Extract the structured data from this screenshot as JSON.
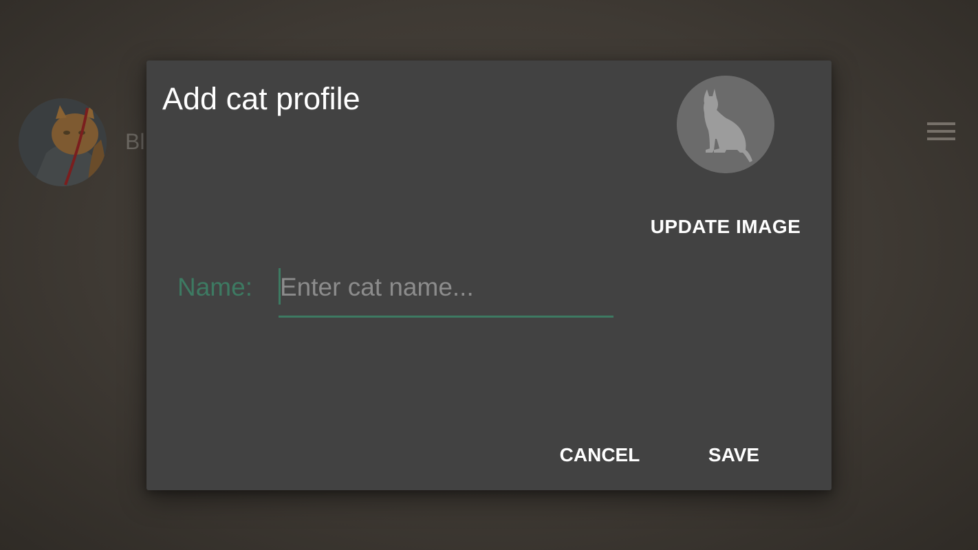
{
  "background": {
    "list_item_name": "Bl",
    "avatar_icon": "cat-photo",
    "menu_icon": "hamburger-menu-icon"
  },
  "dialog": {
    "title": "Add cat profile",
    "image_icon": "cat-silhouette-icon",
    "update_image_label": "UPDATE IMAGE",
    "name_label": "Name:",
    "name_value": "",
    "name_placeholder": "Enter cat name...",
    "cancel_label": "CANCEL",
    "save_label": "SAVE"
  },
  "colors": {
    "accent": "#3d7a62",
    "dialog_background": "#424242",
    "scrim": "#3f3a34",
    "text_primary": "#ffffff",
    "text_hint": "#8c8c8c"
  }
}
